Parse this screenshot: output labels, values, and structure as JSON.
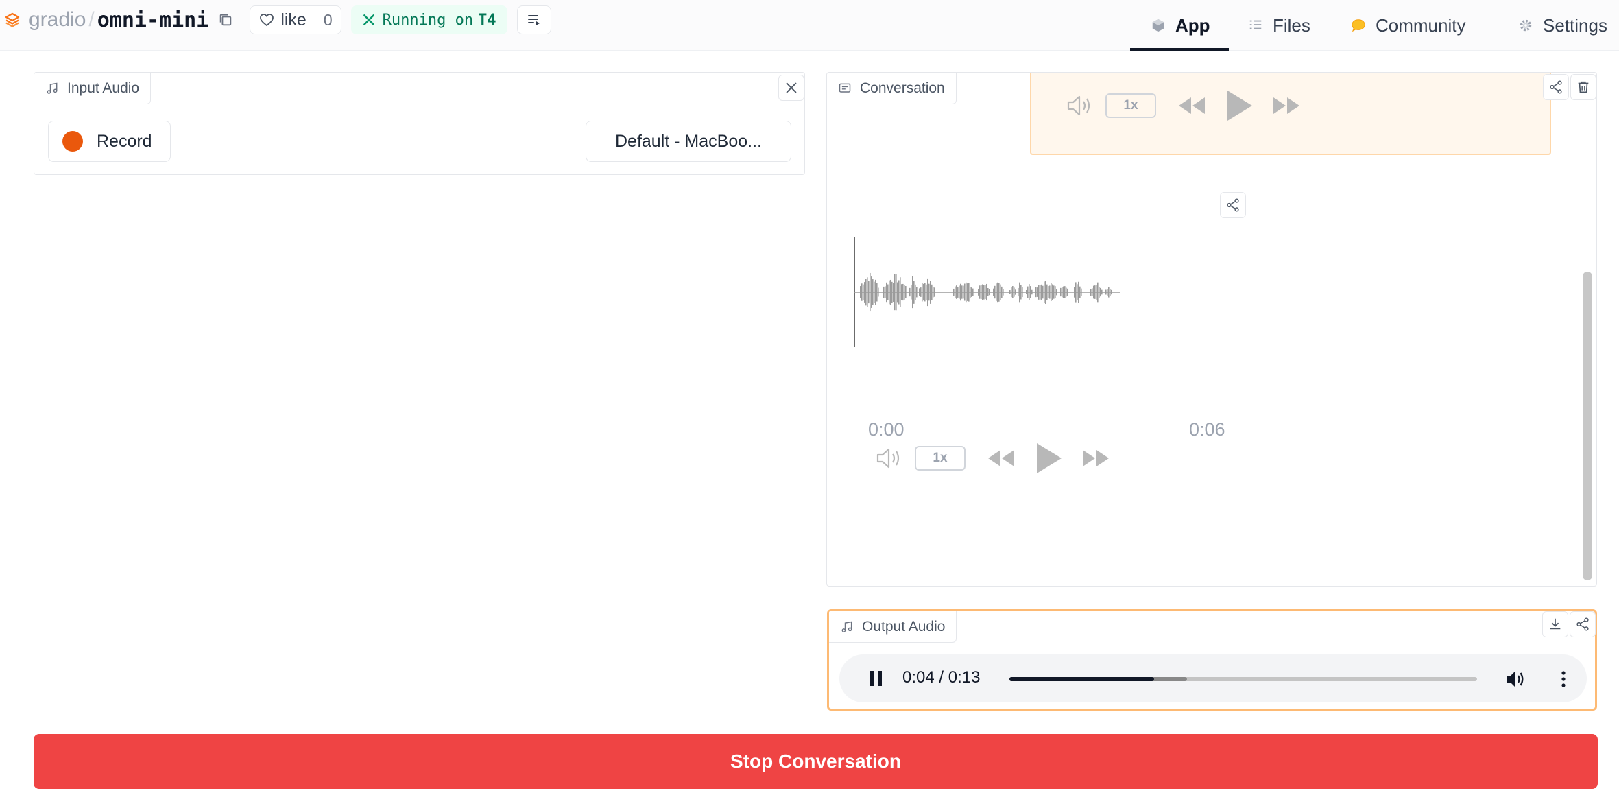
{
  "header": {
    "owner": "gradio",
    "separator": "/",
    "repo": "omni-mini",
    "like_label": "like",
    "like_count": "0",
    "status_prefix": "Running on",
    "status_hardware": "T4",
    "nav": [
      {
        "label": "App",
        "icon": "cube-icon",
        "active": true
      },
      {
        "label": "Files",
        "icon": "files-icon",
        "active": false
      },
      {
        "label": "Community",
        "icon": "community-icon",
        "active": false
      },
      {
        "label": "Settings",
        "icon": "gear-icon",
        "active": false
      }
    ]
  },
  "input_audio": {
    "label": "Input Audio",
    "record_label": "Record",
    "device_label": "Default - MacBoo..."
  },
  "conversation": {
    "label": "Conversation",
    "top_speed": "1x",
    "waveform": {
      "time_start": "0:00",
      "time_end": "0:06",
      "speed": "1x"
    }
  },
  "output_audio": {
    "label": "Output Audio",
    "time": "0:04 / 0:13",
    "progress_fraction": 0.31,
    "buffered_fraction": 0.38
  },
  "stop_button": {
    "label": "Stop Conversation"
  },
  "colors": {
    "accent_orange": "#ea580c",
    "stop_red": "#ef4444",
    "running_green": "#047857",
    "bubble_bg": "#fff7ed",
    "output_border": "#fdba74"
  }
}
